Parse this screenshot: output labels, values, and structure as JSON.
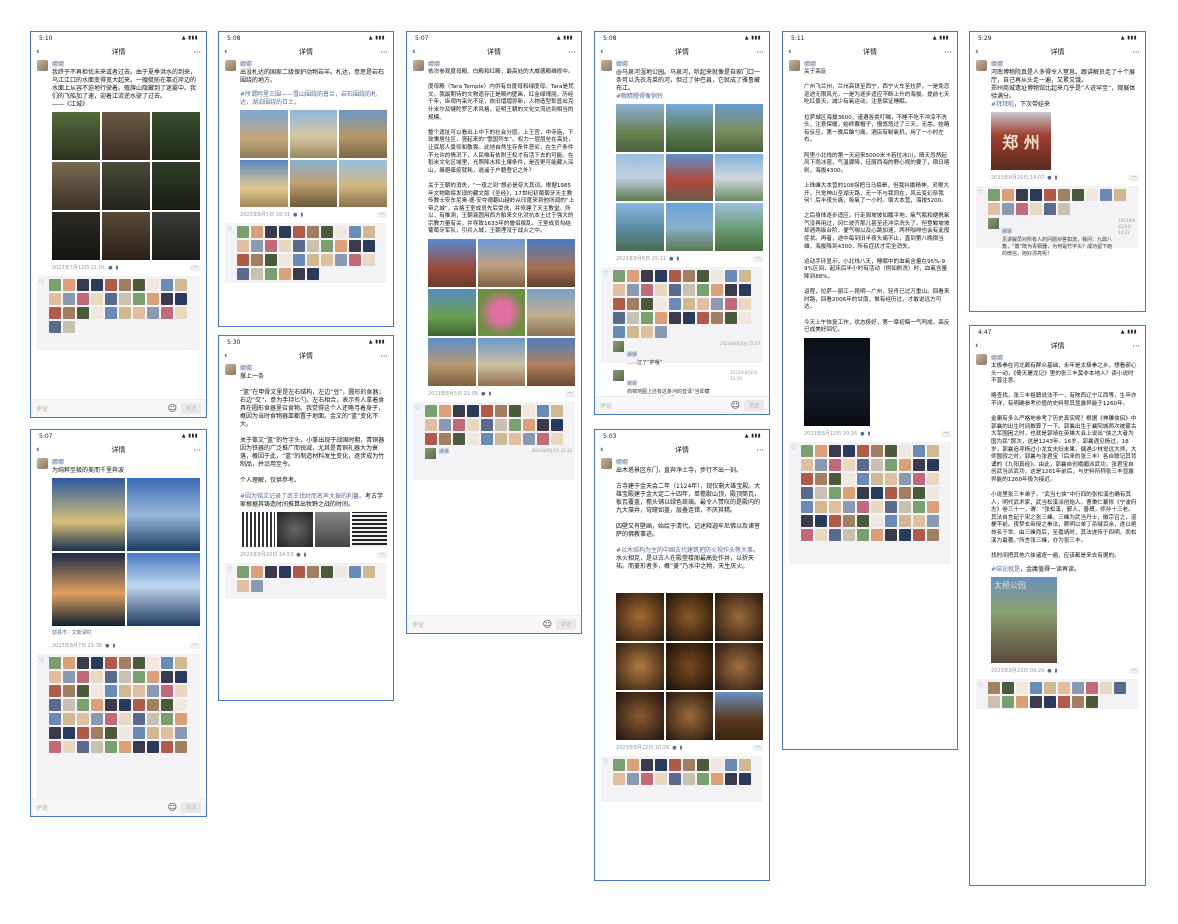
{
  "common": {
    "title": "详情",
    "back": "‹",
    "more": "···",
    "username": "娜娜",
    "comment_placeholder": "评论",
    "send": "发送",
    "emoji": "☺",
    "like": "♡"
  },
  "p1": {
    "time": "5:10",
    "text": "我终于不再担忧未来或者过去。由于夏季洪水的到来，乌江江口的水面变得宽大起来。一艘艇舫在靠近岸边的水面上从容不迫地行驶着。殖旗山隐藏到了迷雾中。我们的飞船加了速，迎着江流逆水驶了过去。\n——《江城》",
    "date": "2023年7月12日 21:01"
  },
  "p2": {
    "time": "5:07",
    "text": "为纯粹至极的美而千里奔波",
    "loc": "郭县市 · 文斯湖村",
    "date": "2023年8月7日 21:36"
  },
  "p3": {
    "time": "5:08",
    "text": "出没札达的国家二级保护动物岩羊。札达，意思是岩石围绕的地方。",
    "link": "#所谓阿里三围——雪山围绕的普兰，岩石围绕的札达，湖泊围绕的日土。",
    "date": "2023年8月5日 18:31"
  },
  "p4": {
    "time": "5:30",
    "text": "撑上一条\n\n“篮”在甲骨文里是左右结构，左边“豆”，圆形的食器；右边“攵”，意为手持匕勺。左右相合，表示有人拿着食具在圆形食器里召食物。我觉得这个人还略弓着身子，概因为当时食物器皿都置于地面。金文的“篮”变化不大。\n\n关于篆文“篮”的竹字头，小篆出现于战国时期，青铜器因为铁器的广泛推广而锐减，尤其是青铜礼器大为衰落，概因于此，“篮”的制造材料发生变化，逐步成为竹制品，并沿用至今。\n\n个人理解，仅供参考。",
    "link": "#因为铭文记录了武王伐纣而名声大振的利簋。",
    "link2": "考古学家根据其铸造时间推算出牧野之战的时间。",
    "date": "2023年8月20日 14:53"
  },
  "p5": {
    "time": "5:07",
    "text": "依次参观度母殿、白殿和红殿，最高处的大威德殿维修中。\n\n度母殿（Tara Temple）内供有白度母和绿度母。Tara是梵文。我最期待的文物遗存正是殿内壁画，红金绿瑰丽，历经千年，纵观内采光不足，依旧熠熠弥新，人物造型彰显出克什米尔及犍陀罗艺术风格，证明王朝的文化交流达到相当的规模。\n\n整个遗址可以看出上中下的社会分层。上王宫，中寺庙，下玫秉居住区，竖起来的“雪国列车”。权力一层层垒在高处，让底层人景仰和敬畏。此地自然生存条件恶劣，在生产条件不允许的情况下，人民唯有依附王权才有活下去的可能。在稻米文化区域里，光照降水和土壤条件，是否更可能藏入深山，躲避瘴疫就耗，逍遥于户籍登记之外？\n\n关于王朝的消失，“一夜之间”想必是夸大其词。根据1985年文物勘探发现的藏文版《圣经》，17世纪初葡萄牙天主教传教士安东尼奥·德·安夺德翻山越岭从印度来到他所闻的“上帝之城”，古格王室成员先后受洗，并修建了天主教堂。所以，有推测，王朝衰圆用西方舶来文化对抗本土过于强大的宗教力量有关，并导致1633年的僧侣叛乱。王室成员勾结葡萄牙军队，引兵入城，王朝湮没于战火之中。",
    "date": "2023年8月5日 21:08",
    "date2": "2023年8月5日 21:12"
  },
  "p6": {
    "time": "5:08",
    "text": "@马泉河湿地公园。马泉河，听起来就像是自家门口一条可以洗衣洗菜的河，但过了仲巴县，它就成了雅鲁藏布江。",
    "link": "#眼睛瞪得像铜铃",
    "date": "2023年8月6日 15:11",
    "c1": "……过了“萨嘎”",
    "c1t": "2023年8月6日 15:17",
    "c2": "商锦地图上还有这条河的音译“当却藏布”，“马泉河”是意译。",
    "c2t": "2023年8月6日 15:19"
  },
  "p7": {
    "time": "5:03",
    "text": "出木塔景区东门，直奔净土寺，步行不出一刻。\n\n古寺建于金天会二年（1124年），现仅剩大雄宝殿。大雄宝殿建于金大定二十四年，单檐歇山顶，殿顶筒瓦，板瓦覆盖，檐头铺以绿色琉璃。最令人赞叹的是殿内的九大藻井，穹窿如盖，层叠连错，不厌其精。\n\n四壁又有壁画，始绘于清代，记述释迦牟尼佛以及诸菩萨的佛教事迹。",
    "link": "#以木结构为主的中国古代建筑把防火视作头等大事。",
    "link2": "水火相克，是以古人在殿堂楼阁最高处作井，以祈天祐。而菱形者多，概“菱”乃水中之物，天生厌火。",
    "date": "2023年8月22日 10:26"
  },
  "p8": {
    "time": "5:11",
    "text": "关于高反\n\n广州飞兰州，兰州高铁至西宁，西宁火车至拉萨，一是免恋迩途无限风光，一是为逐步适应不断上升的海拔。提前七天吃红景天，减少有氧运动，注意保证睡眠。\n\n拉萨城区海拔3600，谨遵各类叮嘱，不睡不吃不冲凉不洗头，注意保暖，始终戴帽子，慢悠悠过了三天，无恙。娃略有反应，第一晚后脑勺痛，酒店有制氧机，用了一小时左右。\n\n阿里小北线的第一天迎来5000米卡若拉冰川，晴天忽然起风下雨冰雹，气温骤降，征服西海的野心视的要了，宿日喀则，海拔4300。\n\n上珠峰大本营的108拐把马马搞晕，但我抖擞精神，灵根大开，只觉神山圣湖天路，无一不与我同在，风云变幻奈我何！后半夜头痛，吸氧了一小时。宿大本营，海拔5200。\n\n之后身体逐步适应。行走周坡坡如履平地，氧气瓶和便携氧气没再用过，冈仁波齐那儿甚至还冲凉洗头了。但登鲅坡坡却遇两级台阶，便气喘以及心跳加速，两杯咖啡也会有此般症状。再者，途中每到旧半夜头痛不止，直到第八晚宿当雄，海拔降到4300，所有症状才完全消失。\n\n运动手环显示，小北线八天，睡眠中的血氧含量在95%-99%区间，起床后半小时有活动（例如刷洗）时，血氧含量降到88%。\n\n返程，拉萨—丽江—昆明—广州，轻舟已过万重山。回看来时路，回看2006年的甘南，惟有经历过，才敢说远方可达。\n\n今天上午恢复工作，状态极好，第一章初稿一气呵成，高反已成美好回忆。",
    "date": "2023年8月12日 20:26"
  },
  "p9": {
    "time": "5:29",
    "text": "河南博物院真是人多得令人窒息。跟讲解员走了十个展厅，自己再从头走一遍，又累又饿。\n郑州商城遗址博物馆比起来几乎是“人迹罕至”，观展体验满分。",
    "link": "#拜拜啦",
    "link2": "，下次带娃来",
    "date": "2023年8月20日 14:07",
    "c1": "见讲解员对所有人的问题对答如流，我问：九鼎八簋，“簋”既为青铜器，为何是竹字头？成功留下她的微信，她好漂亮呢！",
    "c1t": "2023年8月20日 14:23",
    "sign": "郑 州"
  },
  "p10": {
    "time": "4:47",
    "text": "太极拳在河北颇有群众基础，永年是太极拳之乡，想看郝心头一动，《倚天屠龙记》里的张三丰莫非本地人？读小说时不曾注意。\n\n略查找，张三丰祖籍说法不一，有陕西辽宁江西等，生卒亦不详，有明确参考价值的史料称其显露异能于1260年。\n\n金庸有多么严格地参考了历史真实呢？根据《神雕侠侣》中郭襄的出生时间推算了一下。郭襄出生于襄阳城两次被蒙古大军围困之时，也就是郭靖在英雄大会上说出“侠之大者为国为民”那次，这是1243年。16岁，郭襄遇见杨过，18岁，郭襄追寻杨过小龙女夫妇未果，偶遇少林觉远大师，大师圆寂之时，郭襄与张君宝（后来的张三丰）各自联记其背诵的《九阳真经》。由此，郭襄自创峨嵋派武功，张君宝自创武当派武功，这是1261年前后，与史料所称张三丰显露异能的1260年极为接近。\n\n小说里张三丰弟子，“武当七侠”中行四的张松溪也确有其人，明代武术家，武当松溪派创始人。曹秉仁纂修《宁波府志》卷三十一，谓：“张松溪，鄞人，善搏，师孙十三老。其法自言起于宋之张三峰。三峰为武当丹士，徽宗召之，道梗不前。夜梦玄帝授之拳法，厥明以单丁杀贼百余，遂以绝技名于世。由三峰而后，至嘉靖时，其法遂传于四明，而松溪为最著。”所言张三峰，亦为张三丰。\n\n找时间把其他六侠诸逐一遍，应该都是来去有据的。",
    "link": "#结论就是",
    "link2": "，金庸值得一读再读。",
    "date": "2023年8月23日 09:29",
    "sign": "太極公园"
  }
}
